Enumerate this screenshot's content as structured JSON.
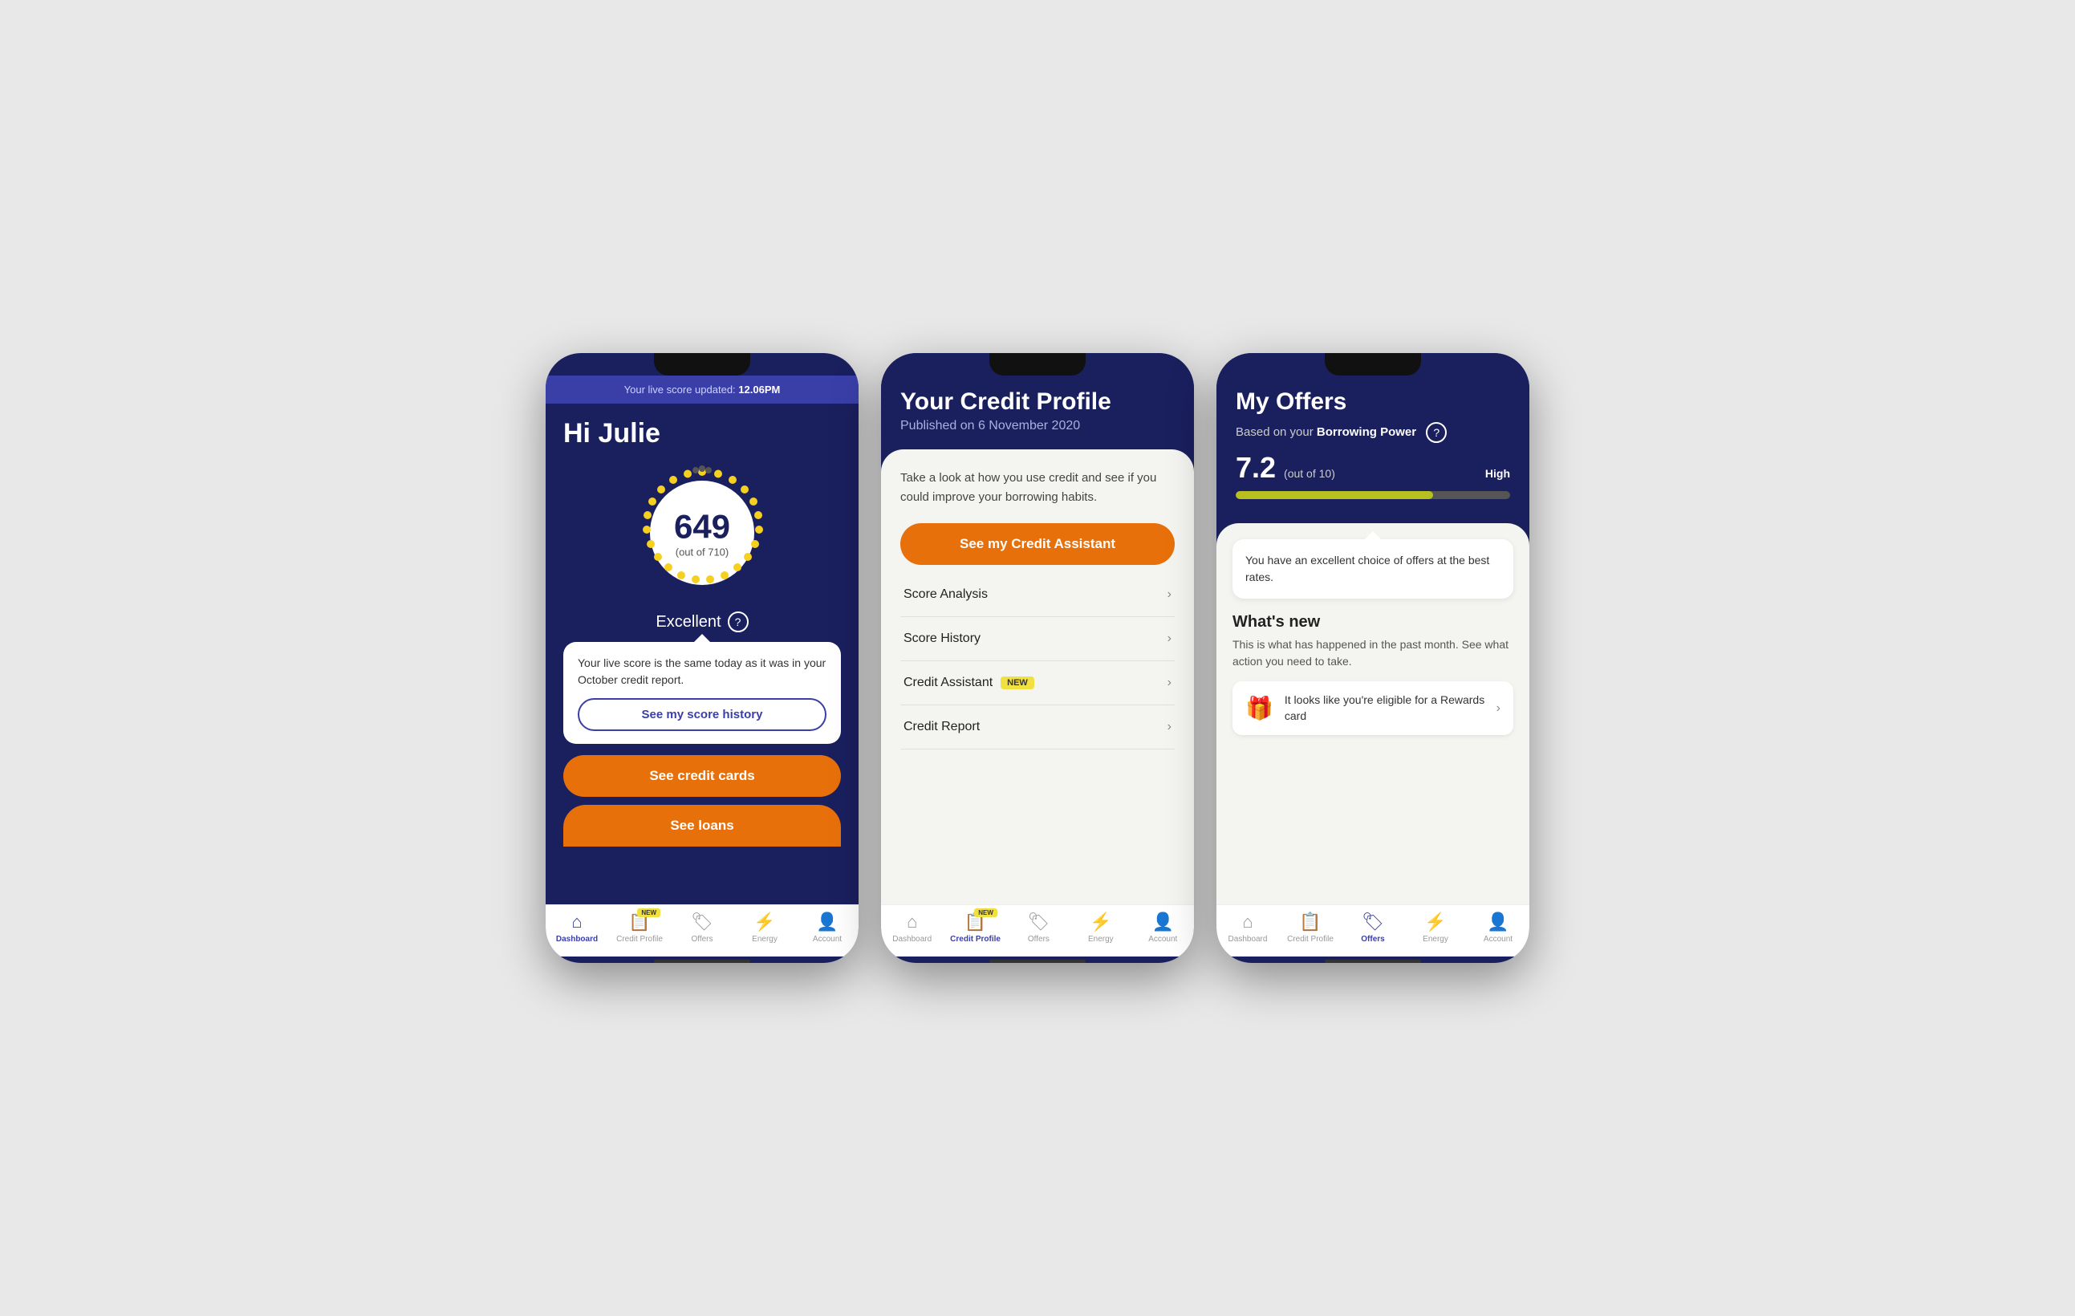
{
  "phone1": {
    "banner": "Your live score updated: ",
    "banner_time": "12.06PM",
    "greeting": "Hi Julie",
    "score": "649",
    "score_outof": "(out of 710)",
    "score_label": "Excellent",
    "bubble_text": "Your live score is the same today as it was in your October credit report.",
    "bubble_btn": "See my score history",
    "orange_btn1": "See credit cards",
    "orange_btn2": "See loans",
    "nav": {
      "items": [
        {
          "label": "Dashboard",
          "active": true
        },
        {
          "label": "Credit Profile",
          "new": true
        },
        {
          "label": "Offers"
        },
        {
          "label": "Energy"
        },
        {
          "label": "Account"
        }
      ]
    }
  },
  "phone2": {
    "title": "Your Credit Profile",
    "subtitle": "Published on 6 November 2020",
    "desc": "Take a look at how you use credit and see if you could improve your borrowing habits.",
    "cta_btn": "See my Credit Assistant",
    "menu_items": [
      {
        "label": "Score Analysis",
        "new": false
      },
      {
        "label": "Score History",
        "new": false
      },
      {
        "label": "Credit Assistant",
        "new": true
      },
      {
        "label": "Credit Report",
        "new": false
      }
    ],
    "nav": {
      "items": [
        {
          "label": "Dashboard"
        },
        {
          "label": "Credit Profile",
          "active": true,
          "new": true
        },
        {
          "label": "Offers"
        },
        {
          "label": "Energy"
        },
        {
          "label": "Account"
        }
      ]
    }
  },
  "phone3": {
    "title": "My Offers",
    "subtitle_pre": "Based on your ",
    "subtitle_bold": "Borrowing Power",
    "score": "7.2",
    "score_outof": "(out of 10)",
    "score_high": "High",
    "progress_pct": 72,
    "speech_text": "You have an excellent choice of offers at the best rates.",
    "whats_new_title": "What's new",
    "whats_new_desc": "This is what has happened in the past month. See what action you need to take.",
    "offer_text": "It looks like you're eligible for a Rewards card",
    "nav": {
      "items": [
        {
          "label": "Dashboard"
        },
        {
          "label": "Credit Profile"
        },
        {
          "label": "Offers",
          "active": true
        },
        {
          "label": "Energy"
        },
        {
          "label": "Account"
        }
      ]
    }
  }
}
